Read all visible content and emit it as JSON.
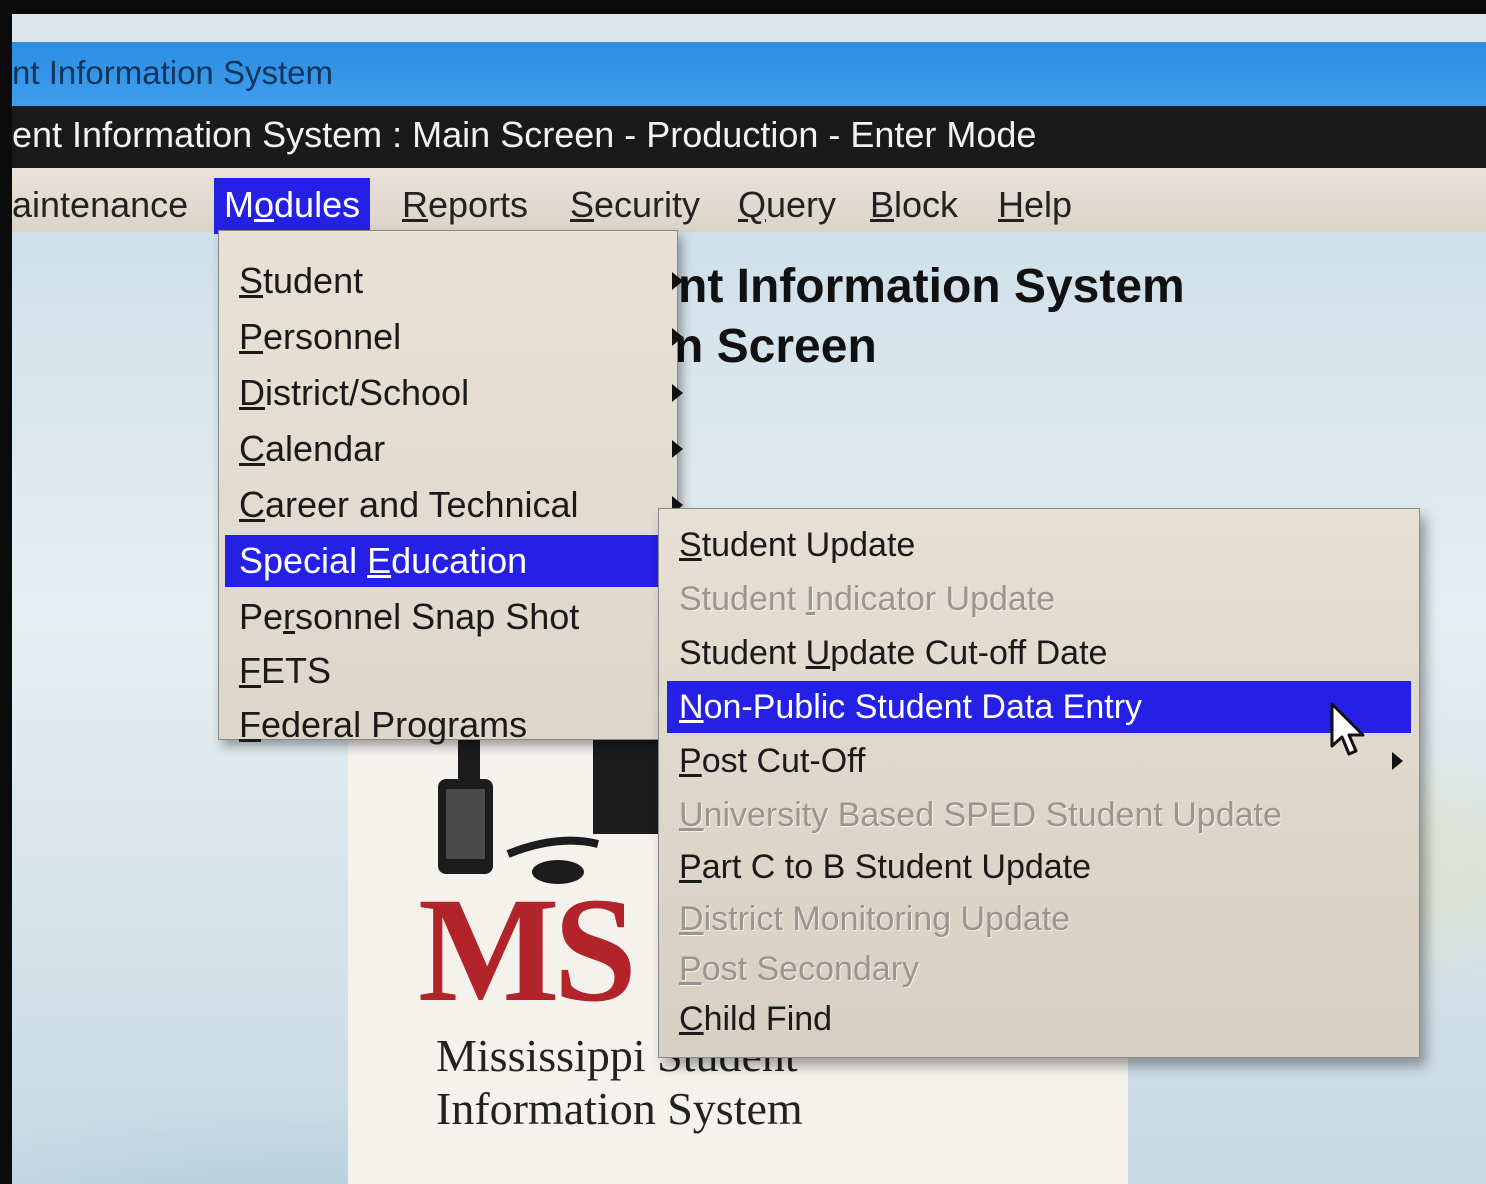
{
  "app": {
    "titlebar": "nt Information System",
    "window_title": "ent Information System : Main Screen  -  Production  -  Enter Mode"
  },
  "menubar": {
    "items": [
      {
        "pre": "",
        "key": "",
        "post": "aintenance"
      },
      {
        "pre": "M",
        "key": "o",
        "post": "dules"
      },
      {
        "pre": "",
        "key": "R",
        "post": "eports"
      },
      {
        "pre": "",
        "key": "S",
        "post": "ecurity"
      },
      {
        "pre": "",
        "key": "Q",
        "post": "uery"
      },
      {
        "pre": "",
        "key": "B",
        "post": "lock"
      },
      {
        "pre": "",
        "key": "H",
        "post": "elp"
      }
    ]
  },
  "main": {
    "heading1": "nt Information System",
    "heading2": "n Screen"
  },
  "logo": {
    "mark": "MS",
    "line1": "Mississippi Student",
    "line2": "Information System"
  },
  "modules_menu": {
    "items": [
      {
        "pre": "",
        "key": "S",
        "post": "tudent"
      },
      {
        "pre": "",
        "key": "P",
        "post": "ersonnel"
      },
      {
        "pre": "",
        "key": "D",
        "post": "istrict/School"
      },
      {
        "pre": "",
        "key": "C",
        "post": "alendar"
      },
      {
        "pre": "",
        "key": "C",
        "post": "areer and Technical"
      },
      {
        "pre": "Special ",
        "key": "E",
        "post": "ducation"
      },
      {
        "pre": "Pe",
        "key": "r",
        "post": "sonnel Snap Shot"
      },
      {
        "pre": "",
        "key": "F",
        "post": "ETS"
      },
      {
        "pre": "",
        "key": "F",
        "post": "ederal Programs"
      }
    ]
  },
  "special_education_menu": {
    "items": [
      {
        "pre": "",
        "key": "S",
        "post": "tudent Update"
      },
      {
        "pre": "Student ",
        "key": "I",
        "post": "ndicator Update"
      },
      {
        "pre": "Student ",
        "key": "U",
        "post": "pdate Cut-off Date"
      },
      {
        "pre": "",
        "key": "N",
        "post": "on-Public Student Data Entry"
      },
      {
        "pre": "",
        "key": "P",
        "post": "ost Cut-Off"
      },
      {
        "pre": "",
        "key": "U",
        "post": "niversity Based SPED Student Update"
      },
      {
        "pre": "",
        "key": "P",
        "post": "art C to B Student Update"
      },
      {
        "pre": "",
        "key": "D",
        "post": "istrict Monitoring Update"
      },
      {
        "pre": "",
        "key": "P",
        "post": "ost Secondary"
      },
      {
        "pre": "",
        "key": "C",
        "post": "hild Find"
      }
    ]
  },
  "colors": {
    "highlight": "#2520e6",
    "titlebar": "#3f9ff0",
    "window_title_bg": "#1a1a1a",
    "disabled_text": "#9a968f",
    "logo_red": "#b2232a"
  }
}
